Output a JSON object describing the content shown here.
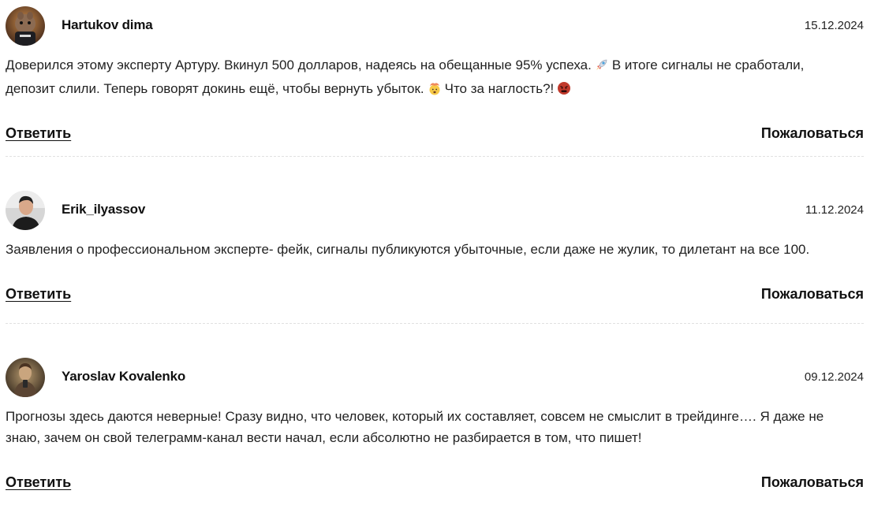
{
  "actions": {
    "reply_label": "Ответить",
    "report_label": "Пожаловаться"
  },
  "comments": [
    {
      "author": "Hartukov dima",
      "date": "15.12.2024",
      "text_parts": [
        "Доверился этому эксперту Артуру. Вкинул 500 долларов, надеясь на обещанные 95% успеха.",
        "В итоге сигналы не сработали, депозит слили. Теперь говорят докинь ещё, чтобы вернуть убыток.",
        "Что за наглость?!"
      ],
      "emojis": [
        "rocket-emoji",
        "exploding-head-emoji",
        "angry-face-emoji"
      ]
    },
    {
      "author": "Erik_ilyassov",
      "date": "11.12.2024",
      "text": "Заявления о профессиональном эксперте- фейк, сигналы публикуются убыточные, если даже не жулик, то дилетант на все 100."
    },
    {
      "author": "Yaroslav Kovalenko",
      "date": "09.12.2024",
      "text": "Прогнозы здесь даются неверные! Сразу видно, что человек, который их составляет, совсем не смыслит в трейдинге…. Я даже не знаю, зачем он свой телеграмм-канал вести начал, если абсолютно не разбирается в том, что пишет!"
    }
  ]
}
